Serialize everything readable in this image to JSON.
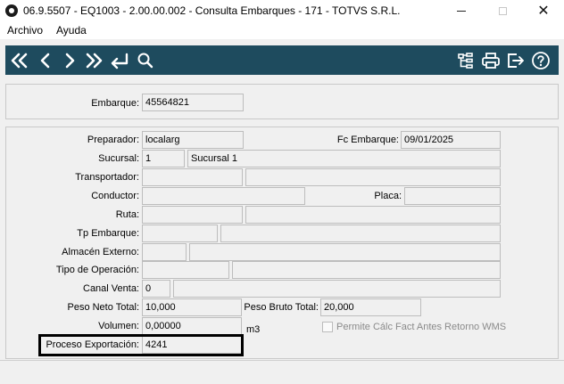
{
  "window": {
    "title": "06.9.5507 - EQ1003 - 2.00.00.002 - Consulta Embarques - 171 - TOTVS S.R.L.",
    "minimize_icon": "minimize-icon",
    "maximize_icon": "maximize-icon",
    "close_glyph": "✕"
  },
  "menu": {
    "items": [
      "Archivo",
      "Ayuda"
    ]
  },
  "toolbar": {
    "background": "#1e4b5e",
    "left_icons": [
      "first-record-icon",
      "previous-record-icon",
      "next-record-icon",
      "last-record-icon",
      "return-icon",
      "search-icon"
    ],
    "right_icons": [
      "hierarchy-icon",
      "print-icon",
      "exit-icon",
      "help-icon"
    ]
  },
  "header": {
    "embarque_label": "Embarque:",
    "embarque_value": "45564821"
  },
  "form": {
    "preparador_label": "Preparador:",
    "preparador_value": "localarg",
    "fc_embarque_label": "Fc Embarque:",
    "fc_embarque_value": "09/01/2025",
    "sucursal_label": "Sucursal:",
    "sucursal_code": "1",
    "sucursal_name": "Sucursal 1",
    "transportador_label": "Transportador:",
    "transportador_code": "",
    "transportador_name": "",
    "conductor_label": "Conductor:",
    "conductor_value": "",
    "placa_label": "Placa:",
    "placa_value": "",
    "ruta_label": "Ruta:",
    "ruta_code": "",
    "ruta_name": "",
    "tp_embarque_label": "Tp Embarque:",
    "tp_embarque_code": "",
    "tp_embarque_name": "",
    "almacen_label": "Almacén Externo:",
    "almacen_code": "",
    "almacen_name": "",
    "tipo_operacion_label": "Tipo de Operación:",
    "tipo_operacion_code": "",
    "tipo_operacion_name": "",
    "canal_venta_label": "Canal Venta:",
    "canal_venta_code": "0",
    "canal_venta_name": "",
    "peso_neto_label": "Peso Neto Total:",
    "peso_neto_value": "10,000",
    "peso_bruto_label": "Peso Bruto Total:",
    "peso_bruto_value": "20,000",
    "volumen_label": "Volumen:",
    "volumen_value": "0,00000",
    "volumen_unit": "m3",
    "permite_label": "Permite Cálc Fact Antes Retorno WMS",
    "permite_checked": false,
    "proceso_label": "Proceso Exportación:",
    "proceso_value": "4241"
  }
}
